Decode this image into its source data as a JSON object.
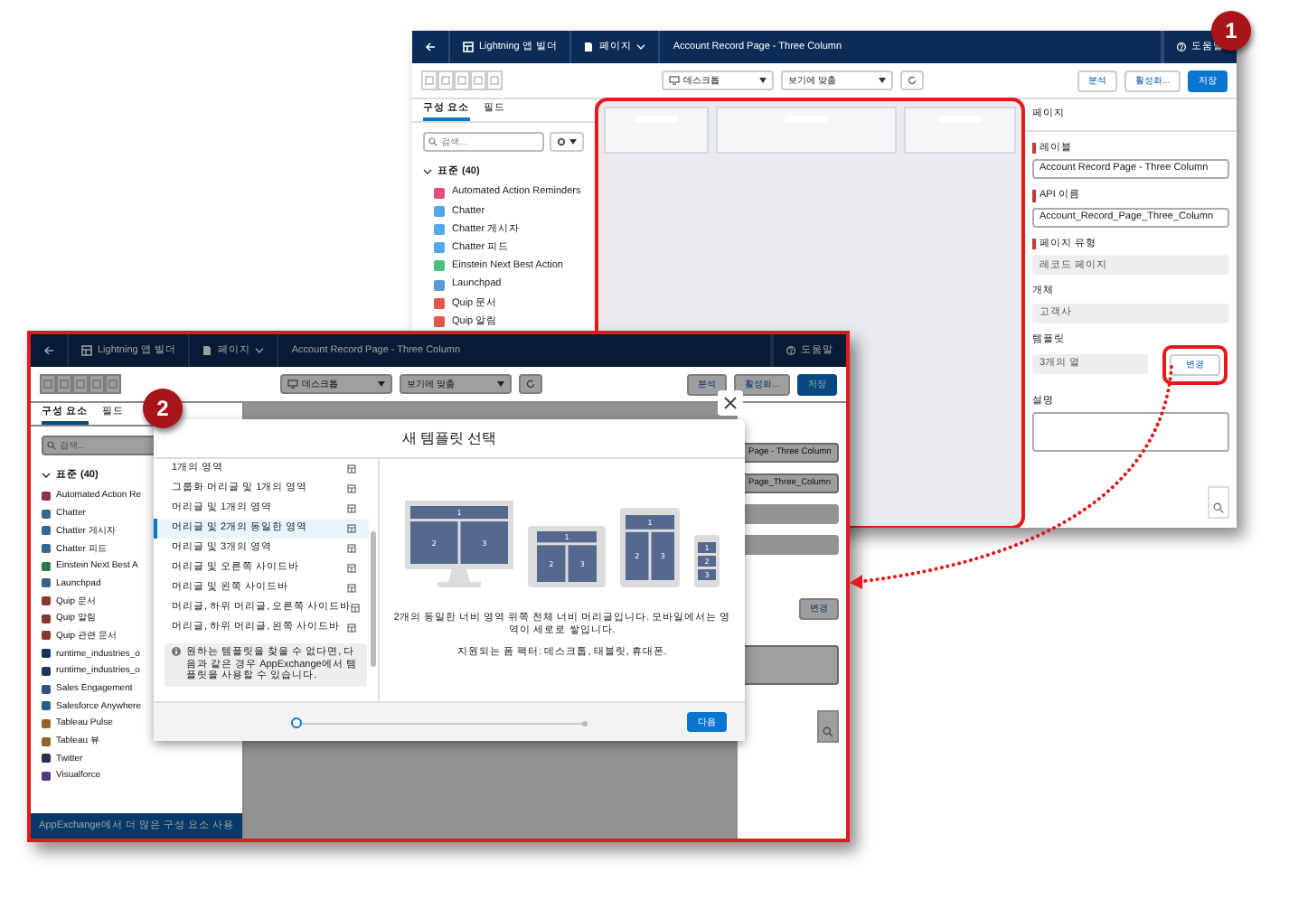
{
  "back_window": {
    "header": {
      "app_label": "Lightning 앱 빌더",
      "page_menu": "페이지",
      "page_title": "Account Record Page - Three Column",
      "help": "도움말"
    },
    "toolbar": {
      "device": "데스크톱",
      "zoom": "보기에 맞춤",
      "buttons": [
        {
          "label": "분석",
          "primary": false
        },
        {
          "label": "활성화...",
          "primary": false
        },
        {
          "label": "저장",
          "primary": true
        }
      ]
    },
    "sidebar": {
      "tabs": [
        {
          "label": "구성 요소",
          "selected": true
        },
        {
          "label": "필드",
          "selected": false
        }
      ],
      "search": {
        "placeholder": "검색..."
      },
      "group": {
        "label": "표준 (40)",
        "expanded": true
      },
      "components": [
        {
          "label": "Automated Action Reminders",
          "color": "#e3507a"
        },
        {
          "label": "Chatter",
          "color": "#54a7e8"
        },
        {
          "label": "Chatter 게시자",
          "color": "#54a7e8"
        },
        {
          "label": "Chatter 피드",
          "color": "#54a7e8"
        },
        {
          "label": "Einstein Next Best Action",
          "color": "#4bc076"
        },
        {
          "label": "Launchpad",
          "color": "#5a9bd5"
        },
        {
          "label": "Quip 문서",
          "color": "#e2574c"
        },
        {
          "label": "Quip 알림",
          "color": "#e2574c"
        }
      ]
    },
    "properties": {
      "title": "페이지",
      "fields": [
        {
          "kind": "text",
          "label": "레이블",
          "required": true,
          "value": "Account Record Page - Three Column"
        },
        {
          "kind": "text",
          "label": "API 이름",
          "required": true,
          "value": "Account_Record_Page_Three_Column"
        },
        {
          "kind": "readonly",
          "label": "페이지 유형",
          "required": true,
          "value": "레코드 페이지"
        },
        {
          "kind": "readonly",
          "label": "개체",
          "required": false,
          "value": "고객사"
        },
        {
          "kind": "readonly",
          "label": "템플릿",
          "required": false,
          "value": "3개의 열",
          "action": "변경"
        },
        {
          "kind": "textarea",
          "label": "설명",
          "required": false
        }
      ]
    },
    "callout": "1"
  },
  "front_window": {
    "header": {
      "app_label": "Lightning 앱 빌더",
      "page_menu": "페이지",
      "page_title": "Account Record Page - Three Column",
      "help": "도움말"
    },
    "toolbar": {
      "device": "데스크톱",
      "zoom": "보기에 맞춤",
      "buttons": [
        {
          "label": "분석",
          "primary": false
        },
        {
          "label": "활성화...",
          "primary": false
        },
        {
          "label": "저장",
          "primary": true
        }
      ]
    },
    "sidebar": {
      "tabs": [
        {
          "label": "구성 요소",
          "selected": true
        },
        {
          "label": "필드",
          "selected": false
        }
      ],
      "search": {
        "placeholder": "검색..."
      },
      "group": {
        "label": "표준 (40)",
        "expanded": true
      },
      "components": [
        {
          "label": "Automated Action Re",
          "color": "#8d324c"
        },
        {
          "label": "Chatter",
          "color": "#346890"
        },
        {
          "label": "Chatter 게시자",
          "color": "#346890"
        },
        {
          "label": "Chatter 피드",
          "color": "#346890"
        },
        {
          "label": "Einstein Next Best A",
          "color": "#2f7749"
        },
        {
          "label": "Launchpad",
          "color": "#386084"
        },
        {
          "label": "Quip 문서",
          "color": "#8c362f"
        },
        {
          "label": "Quip 알림",
          "color": "#8c362f"
        },
        {
          "label": "Quip 관련 문서",
          "color": "#8c362f"
        },
        {
          "label": "runtime_industries_o",
          "color": "#1b365e"
        },
        {
          "label": "runtime_industries_o",
          "color": "#1b365e"
        },
        {
          "label": "Sales Engagement",
          "color": "#38517a"
        },
        {
          "label": "Salesforce Anywhere",
          "color": "#246087"
        },
        {
          "label": "Tableau Pulse",
          "color": "#906526"
        },
        {
          "label": "Tableau 뷰",
          "color": "#906526"
        },
        {
          "label": "Twitter",
          "color": "#26314d"
        },
        {
          "label": "Visualforce",
          "color": "#523683"
        }
      ],
      "footer_link": "AppExchange에서 더 많은 구성 요소 사용"
    },
    "properties": {
      "values": [
        "Page - Three Column",
        "Page_Three_Column"
      ],
      "action": "변경"
    },
    "modal": {
      "title": "새 템플릿 선택",
      "templates": [
        {
          "label": "1개의 영역",
          "selected": false
        },
        {
          "label": "그룹화 머리글 및 1개의 영역",
          "selected": false
        },
        {
          "label": "머리글 및 1개의 영역",
          "selected": false
        },
        {
          "label": "머리글 및 2개의 동일한 영역",
          "selected": true
        },
        {
          "label": "머리글 및 3개의 영역",
          "selected": false
        },
        {
          "label": "머리글 및 오른쪽 사이드바",
          "selected": false
        },
        {
          "label": "머리글 및 왼쪽 사이드바",
          "selected": false
        },
        {
          "label": "머리글, 하위 머리글, 오른쪽 사이드바",
          "selected": false
        },
        {
          "label": "머리글, 하위 머리글, 왼쪽 사이드바",
          "selected": false
        }
      ],
      "info": "원하는 템플릿을 찾을 수 없다면, 다음과 같은 경우 AppExchange에서 템플릿을 사용할 수 있습니다.",
      "preview": {
        "devices": [
          {
            "kind": "desktop",
            "regions": [
              "1",
              "2",
              "3"
            ]
          },
          {
            "kind": "tablet_landscape",
            "regions": [
              "1",
              "2",
              "3"
            ]
          },
          {
            "kind": "tablet_portrait",
            "regions": [
              "1",
              "2",
              "3"
            ]
          },
          {
            "kind": "phone",
            "regions": [
              "1",
              "2",
              "3"
            ]
          }
        ]
      },
      "description": "2개의 동일한 너비 영역 위쪽 전체 너비 머리글입니다. 모바일에서는 영역이 세로로 쌓입니다.",
      "form_factors": "지원되는 폼 팩터: 데스크톱, 태블릿, 휴대폰.",
      "steps": [
        {
          "selected": true
        },
        {
          "selected": false
        }
      ],
      "next_button": "다음"
    },
    "callout": "2"
  }
}
